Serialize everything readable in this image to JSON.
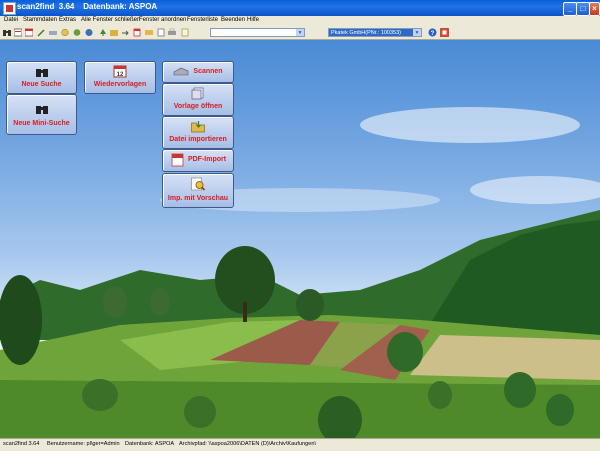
{
  "window": {
    "title": "scan2find  3.64    Datenbank: ASPOA"
  },
  "menu": [
    "Datei",
    "Stammdaten",
    "Extras",
    "Alle Fenster schließen",
    "Fenster anordnen",
    "Fensterliste",
    "Beenden",
    "Hilfe"
  ],
  "toolbar": {
    "search_value": "",
    "company_select": "Pkatek GmbH(PNr.: 100353)"
  },
  "buttons": {
    "neue_suche": "Neue Suche",
    "wiedervorlagen": "Wiedervorlagen",
    "neue_mini_suche": "Neue Mini-Suche",
    "scannen": "Scannen",
    "vorlage_oeffnen": "Vorlage öffnen",
    "datei_importieren": "Datei importieren",
    "pdf_import": "PDF-Import",
    "imp_mit_vorschau": "Imp. mit Vorschau"
  },
  "status": {
    "app": "scan2find  3.64",
    "user": "Benutzername: pl\\ger=Admin",
    "db": "Datenbank: ASPOA",
    "path": "Archivpfad: \\\\aspoa2006\\DATEN (D)\\Archiv\\Kaufungen\\"
  },
  "colors": {
    "title_bar": "#0b54c8",
    "button_text": "#d52020",
    "chrome": "#ece9d8"
  }
}
